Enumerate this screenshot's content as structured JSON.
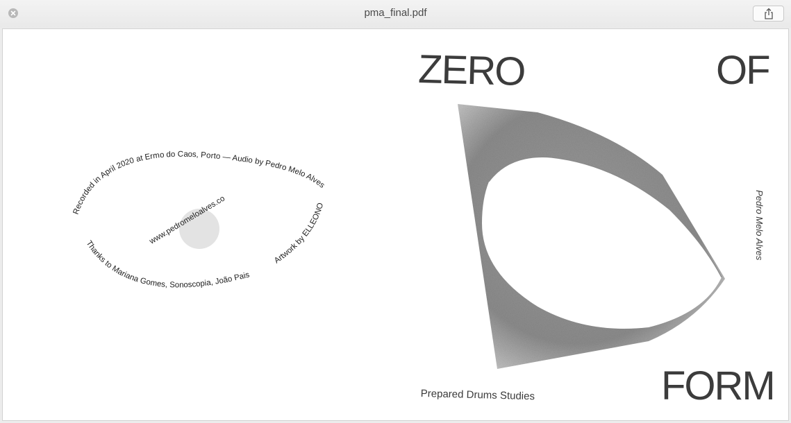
{
  "window": {
    "title": "pma_final.pdf"
  },
  "icons": {
    "close": "close-icon",
    "share": "share-icon"
  },
  "cover": {
    "word_zero": "ZERO",
    "word_of": "OF",
    "word_form": "FORM",
    "subtitle": "Prepared Drums Studies",
    "artist": "Pedro Melo Alves"
  },
  "back": {
    "recorded": "Recorded in April 2020 at Ermo do Caos, Porto — Audio by Pedro Melo Alves",
    "thanks": "Thanks to Mariana Gomes, Sonoscopia, João Pais Filipe",
    "artwork": "Artwork by ELLEONOR",
    "website": "www.pedromeloalves.com"
  },
  "colors": {
    "ink": "#3c3c3c",
    "paper": "#ffffff",
    "dot": "#e3e3e3"
  }
}
